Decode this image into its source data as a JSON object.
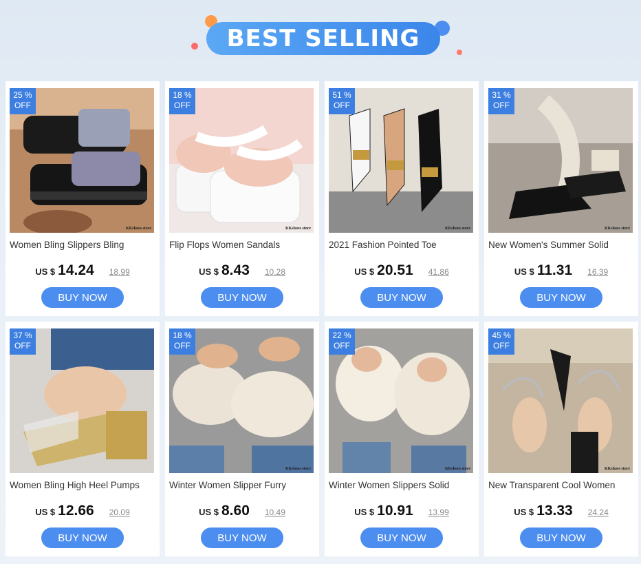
{
  "header": {
    "title": "BEST SELLING"
  },
  "colors": {
    "accent": "#4c8df0",
    "badge": "#3d7fe0",
    "banner": "#3b86ea"
  },
  "products": [
    {
      "discount": "25 %",
      "off": "OFF",
      "title": "Women Bling Slippers Bling",
      "currency": "US $",
      "price": "14.24",
      "old_price": "18.99",
      "buy": "BUY NOW",
      "store": "KKshoes store"
    },
    {
      "discount": "18 %",
      "off": "OFF",
      "title": "Flip Flops Women Sandals",
      "currency": "US $",
      "price": "8.43",
      "old_price": "10.28",
      "buy": "BUY NOW",
      "store": "KKshoes store"
    },
    {
      "discount": "51 %",
      "off": "OFF",
      "title": "2021 Fashion Pointed Toe",
      "currency": "US $",
      "price": "20.51",
      "old_price": "41.86",
      "buy": "BUY NOW",
      "store": "KKshoes store"
    },
    {
      "discount": "31 %",
      "off": "OFF",
      "title": "New Women's Summer Solid",
      "currency": "US $",
      "price": "11.31",
      "old_price": "16.39",
      "buy": "BUY NOW",
      "store": "KKshoes store"
    },
    {
      "discount": "37 %",
      "off": "OFF",
      "title": "Women Bling High Heel Pumps",
      "currency": "US $",
      "price": "12.66",
      "old_price": "20.09",
      "buy": "BUY NOW",
      "store": ""
    },
    {
      "discount": "18 %",
      "off": "OFF",
      "title": "Winter Women Slipper Furry",
      "currency": "US $",
      "price": "8.60",
      "old_price": "10.49",
      "buy": "BUY NOW",
      "store": "KKshoes store"
    },
    {
      "discount": "22 %",
      "off": "OFF",
      "title": "Winter Women Slippers Solid",
      "currency": "US $",
      "price": "10.91",
      "old_price": "13.99",
      "buy": "BUY NOW",
      "store": "KKshoes store"
    },
    {
      "discount": "45 %",
      "off": "OFF",
      "title": "New Transparent Cool Women",
      "currency": "US $",
      "price": "13.33",
      "old_price": "24.24",
      "buy": "BUY NOW",
      "store": "KKshoes store"
    }
  ]
}
